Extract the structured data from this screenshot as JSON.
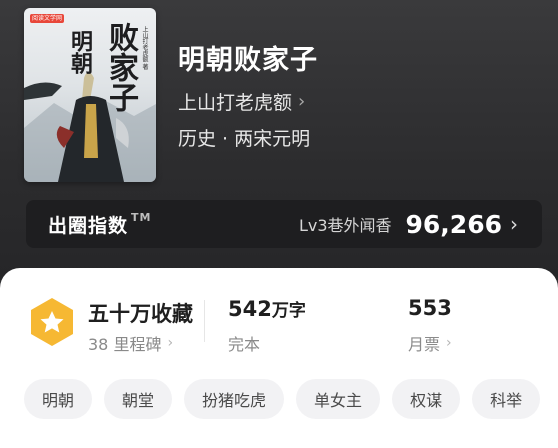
{
  "book": {
    "title": "明朝败家子",
    "author": "上山打老虎额",
    "genre": "历史 · 两宋元明",
    "cover": {
      "publisher_badge": "阅读文学网",
      "title_main": "败家子",
      "title_side": "明朝",
      "author_small": "上山打老虎额 著"
    }
  },
  "index_card": {
    "label": "出圈指数",
    "tm": "TM",
    "level": "Lv3巷外闻香",
    "value": "96,266"
  },
  "stats": {
    "favorites": "五十万收藏",
    "milestones": "38 里程碑",
    "word_count": "542",
    "word_unit": "万字",
    "status": "完本",
    "tickets": "553",
    "tickets_label": "月票"
  },
  "tags": [
    "明朝",
    "朝堂",
    "扮猪吃虎",
    "单女主",
    "权谋",
    "科举"
  ],
  "colors": {
    "header_bg": "#2f2f31",
    "badge_gold": "#f6b833",
    "panel_bg": "#ffffff",
    "tag_bg": "#f2f2f4"
  },
  "icons": {
    "favorite_badge": "hexagon-star-icon",
    "chevron": "chevron-right-icon"
  }
}
